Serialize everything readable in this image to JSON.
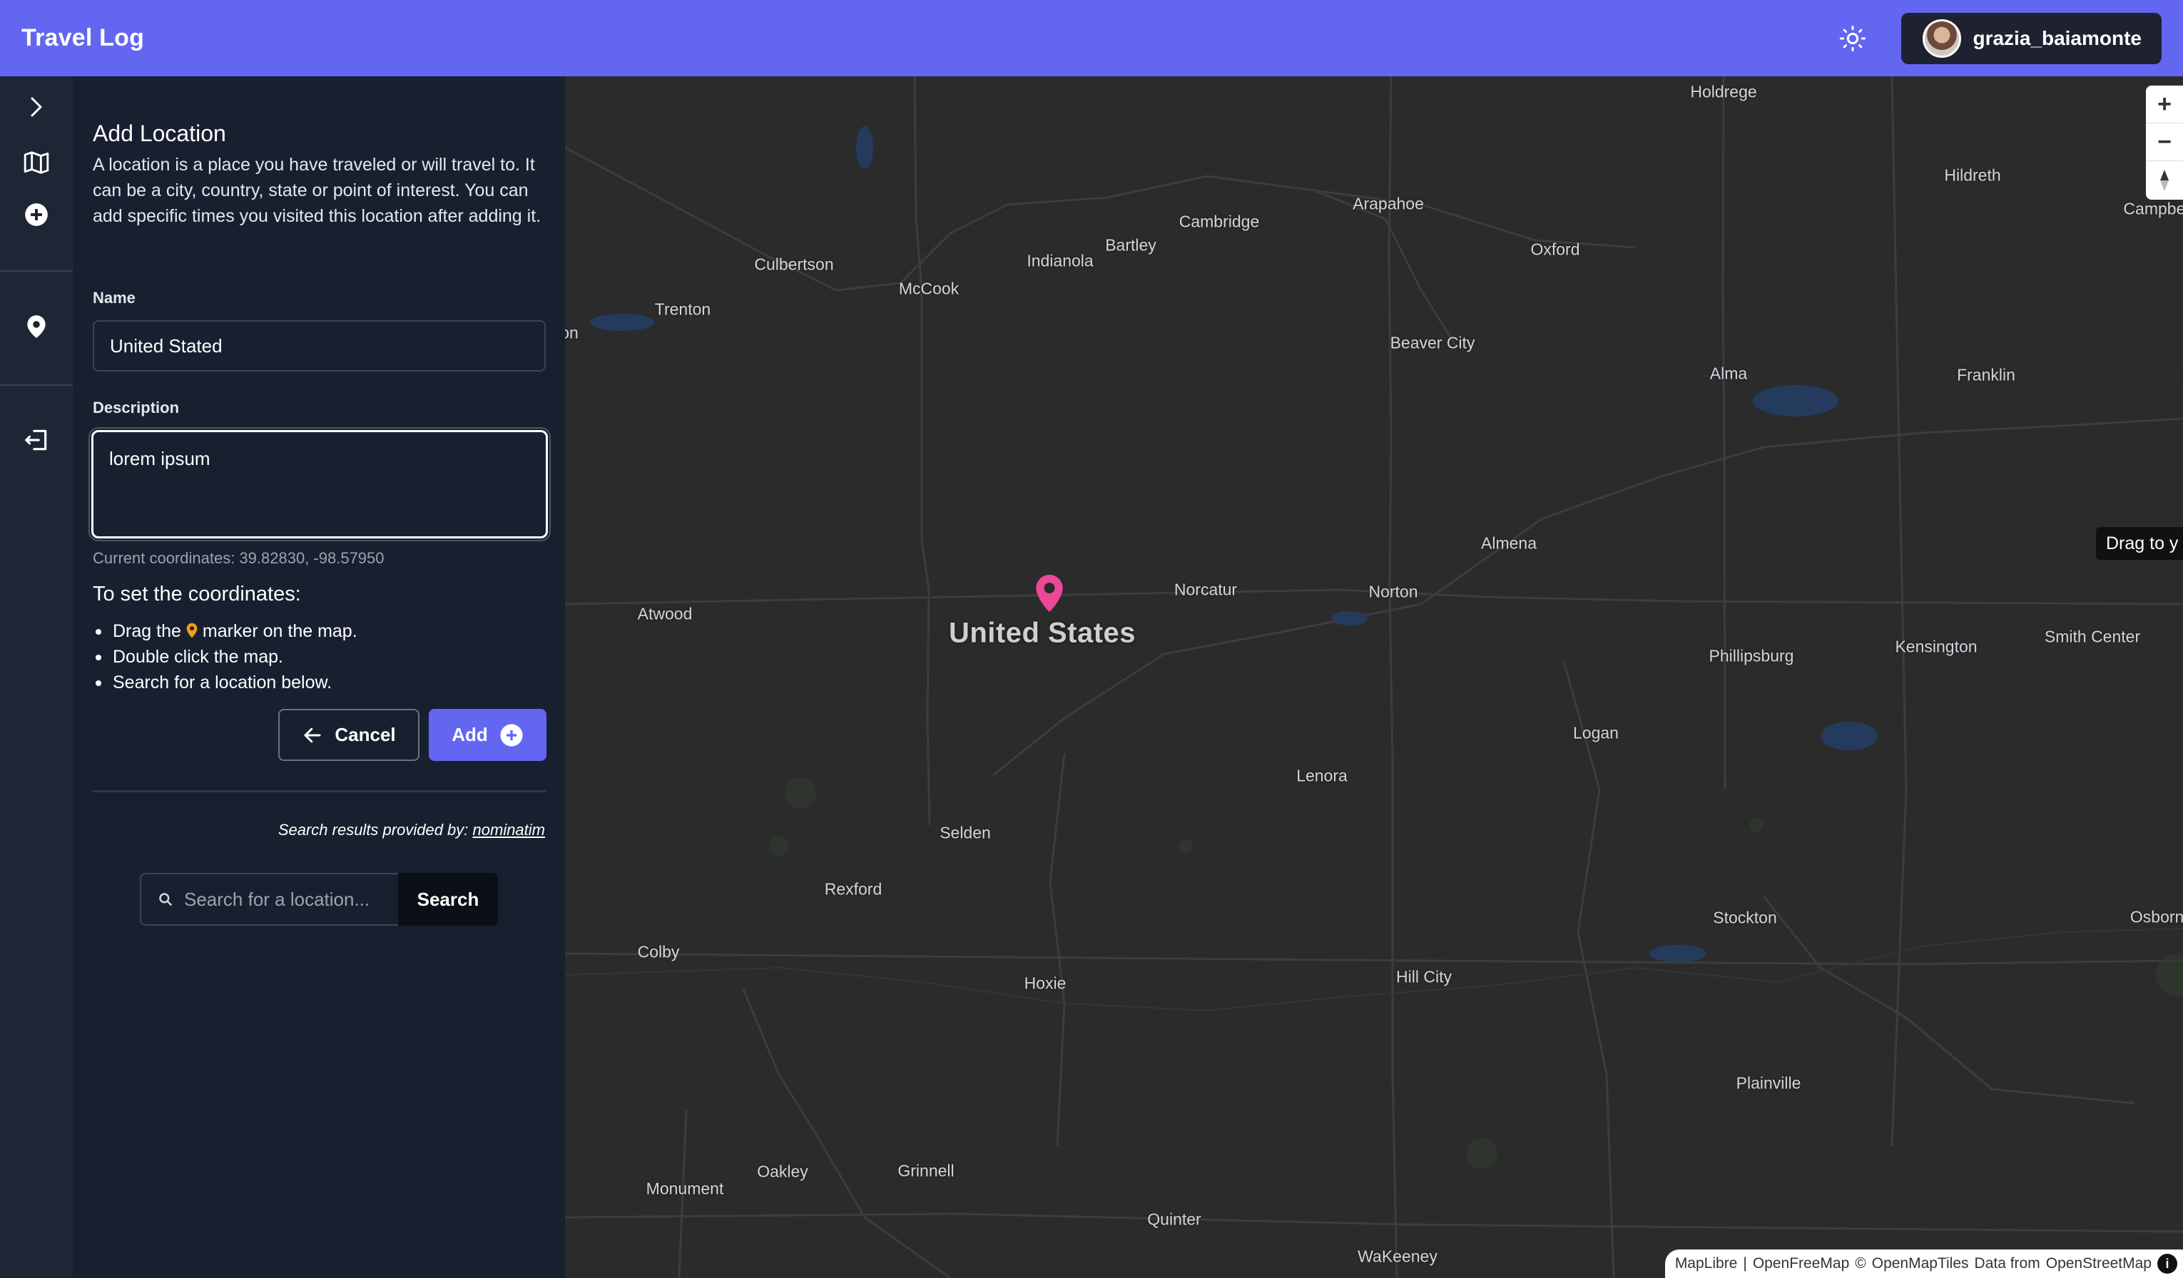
{
  "header": {
    "app_title": "Travel Log",
    "theme_toggle_icon": "sun-icon",
    "user": {
      "username": "grazia_baiamonte",
      "avatar_icon": "avatar"
    }
  },
  "rail": {
    "items": [
      {
        "icon": "chevron-right-icon",
        "label": ""
      },
      {
        "icon": "map-icon",
        "label": ""
      },
      {
        "icon": "plus-circle-icon",
        "label": ""
      },
      {
        "icon": "map-pin-icon",
        "label": ""
      },
      {
        "icon": "sign-out-icon",
        "label": ""
      }
    ]
  },
  "form": {
    "title": "Add Location",
    "description": "A location is a place you have traveled or will travel to. It can be a city, country, state or point of interest. You can add specific times you visited this location after adding it.",
    "name_label": "Name",
    "name_value": "United Stated",
    "description_label": "Description",
    "description_value": "lorem ipsum",
    "coordinates_text": "Current coordinates: 39.82830, -98.57950",
    "set_title": "To set the coordinates:",
    "steps": {
      "drag_before": "Drag the",
      "drag_after": "marker on the map.",
      "double_click": "Double click the map.",
      "search": "Search for a location below."
    },
    "cancel_label": "Cancel",
    "add_label": "Add",
    "provider_text": "Search results provided by:",
    "provider_link": "nominatim",
    "search_placeholder": "Search for a location...",
    "search_button": "Search"
  },
  "map": {
    "country_label": "United States",
    "drag_tip": "Drag to y",
    "attribution": {
      "maplibre": "MapLibre",
      "sep": "|",
      "openfreemap": "OpenFreeMap",
      "copy": "©",
      "openmaptiles": "OpenMapTiles",
      "data_from": "Data from",
      "osm": "OpenStreetMap"
    },
    "towns": [
      "Holdrege",
      "Hildreth",
      "Campbell",
      "Cambridge",
      "Arapahoe",
      "Bartley",
      "Indianola",
      "Culbertson",
      "McCook",
      "Oxford",
      "Trenton",
      "Beaver City",
      "Alma",
      "Franklin",
      "Almena",
      "Norcatur",
      "Norton",
      "Atwood",
      "Phillipsburg",
      "Kensington",
      "Smith Center",
      "Logan",
      "Lenora",
      "Selden",
      "Rexford",
      "Stockton",
      "Osborne",
      "Colby",
      "Hoxie",
      "Hill City",
      "Plainville",
      "Oakley",
      "Grinnell",
      "Monument",
      "Quinter",
      "WaKeeney",
      "on"
    ]
  },
  "colors": {
    "accent": "#6366f1",
    "marker": "#ec4899",
    "panel_bg": "#182030",
    "map_bg": "#2b2b2c"
  }
}
